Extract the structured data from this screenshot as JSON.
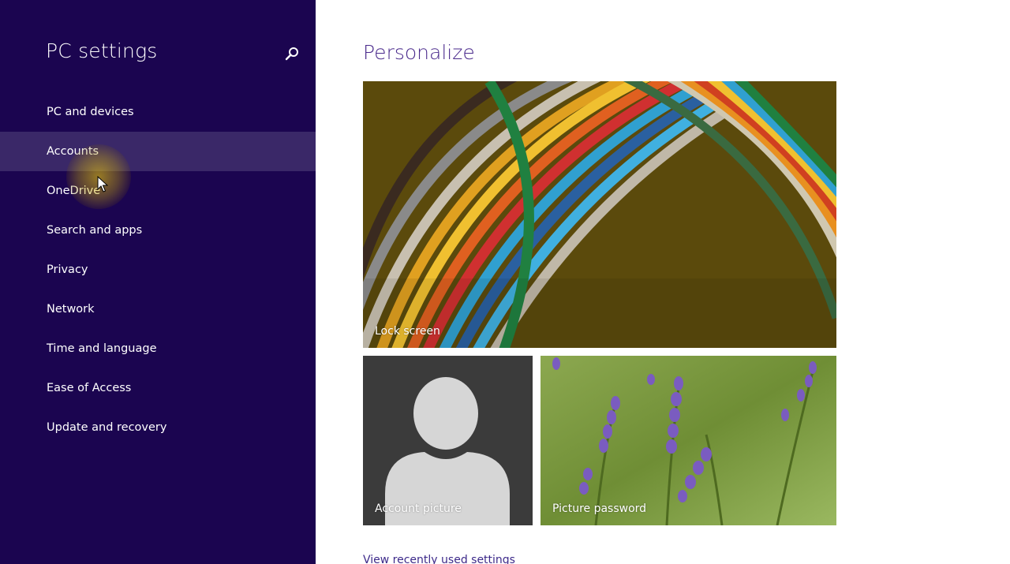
{
  "sidebar": {
    "title": "PC settings",
    "search_icon": "search-icon",
    "items": [
      {
        "label": "PC and devices"
      },
      {
        "label": "Accounts"
      },
      {
        "label": "OneDrive"
      },
      {
        "label": "Search and apps"
      },
      {
        "label": "Privacy"
      },
      {
        "label": "Network"
      },
      {
        "label": "Time and language"
      },
      {
        "label": "Ease of Access"
      },
      {
        "label": "Update and recovery"
      }
    ],
    "selected_item": "Accounts"
  },
  "main": {
    "title": "Personalize",
    "tiles": {
      "lock_screen": {
        "label": "Lock screen"
      },
      "account_picture": {
        "label": "Account picture"
      },
      "picture_password": {
        "label": "Picture password"
      }
    },
    "recent_link": "View recently used settings"
  },
  "colors": {
    "sidebar_bg": "#1b0550",
    "sidebar_selected": "#3a2868",
    "title_accent": "#4a2a8c",
    "link": "#3d2a8a"
  }
}
